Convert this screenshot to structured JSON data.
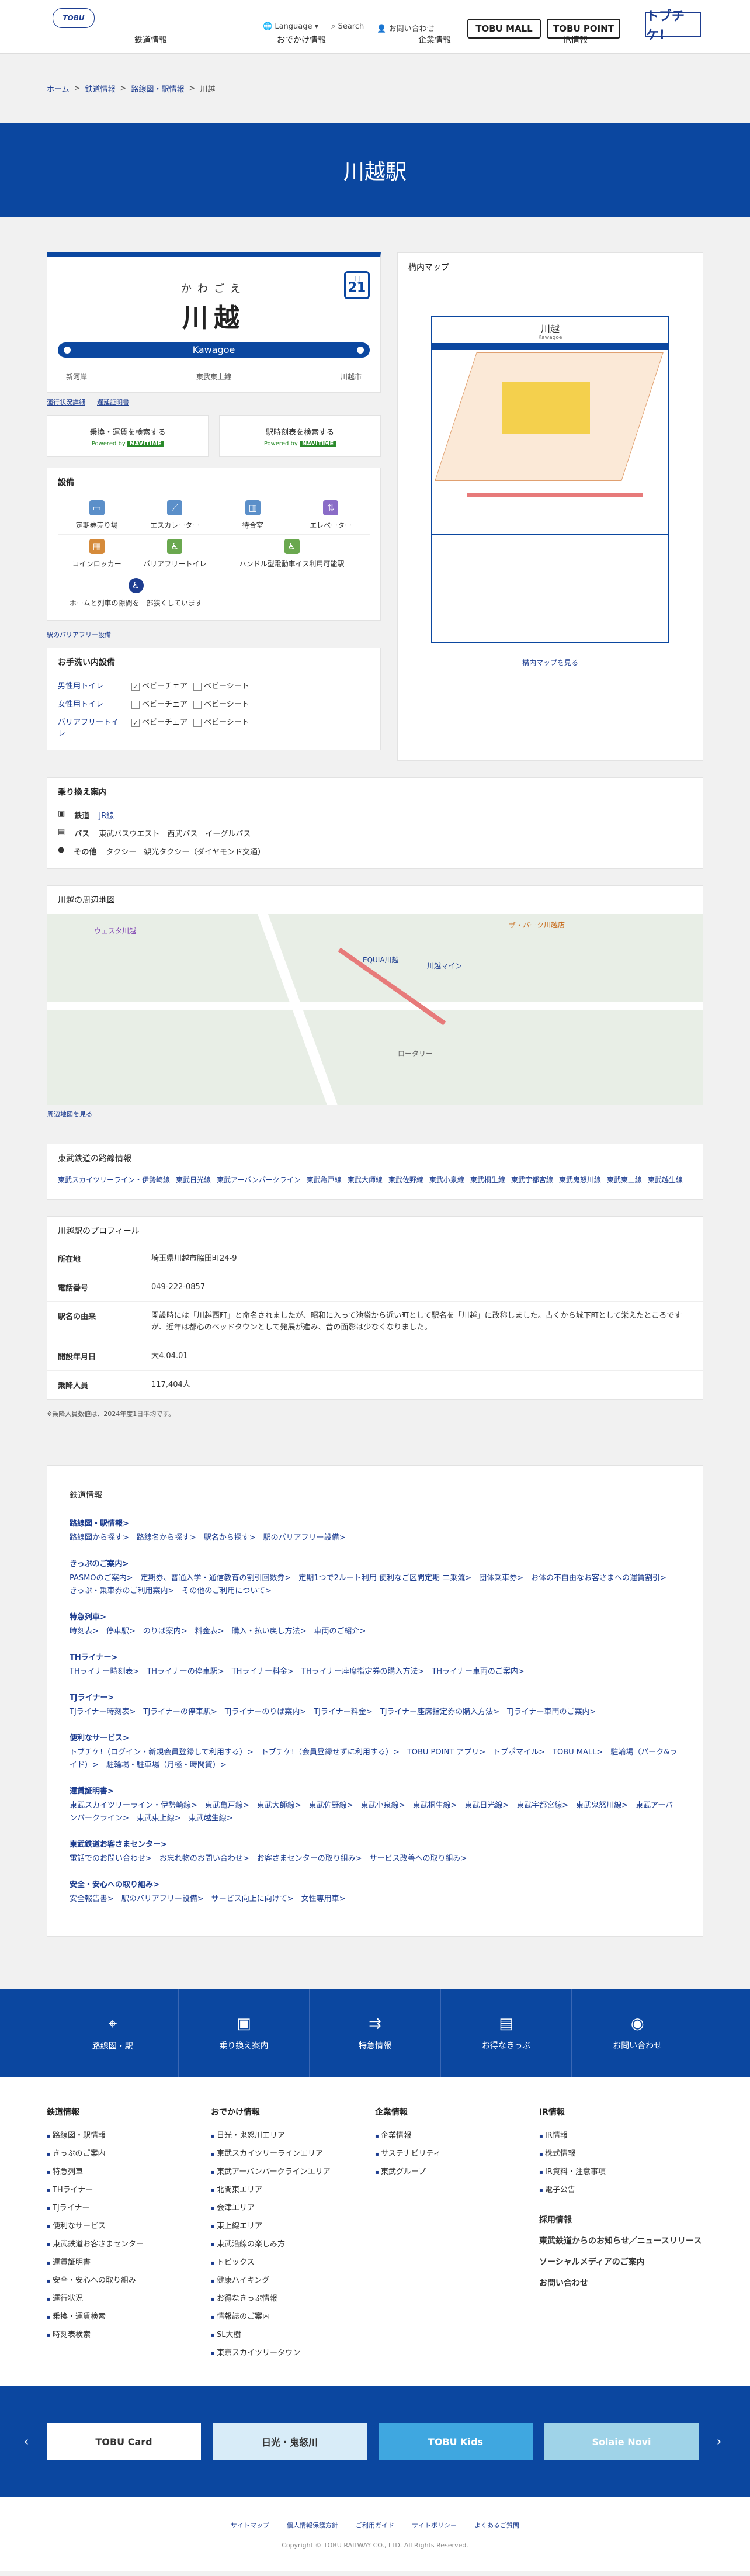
{
  "header": {
    "logo": "TOBU",
    "nav": [
      "鉄道情報",
      "おでかけ情報",
      "企業情報",
      "IR情報"
    ],
    "utility": [
      "Language ▾",
      "Search",
      "お問い合わせ"
    ],
    "brands": [
      "TOBU MALL",
      "TOBU POINT",
      "トブチケ!"
    ]
  },
  "breadcrumb": [
    "ホーム",
    "鉄道情報",
    "路線図・駅情報",
    "川越"
  ],
  "hero_title": "川越駅",
  "sign": {
    "kana": "かわごえ",
    "name": "川越",
    "romaji": "Kawagoe",
    "code_prefix": "TJ",
    "code_num": "21",
    "left": "新河岸",
    "center": "東武東上線",
    "right": "川越市"
  },
  "sign_links": [
    "運行状況詳細",
    "遅延証明書"
  ],
  "search_boxes": [
    {
      "label": "乗換・運賃を検索する",
      "powered": "Powered by",
      "brand": "NAVITIME"
    },
    {
      "label": "駅時刻表を検索する",
      "powered": "Powered by",
      "brand": "NAVITIME"
    }
  ],
  "facilities": {
    "title": "設備",
    "items": [
      "定期券売り場",
      "エスカレーター",
      "待合室",
      "エレベーター",
      "コインロッカー",
      "バリアフリートイレ",
      "ハンドル型電動車イス利用可能駅",
      "ホームと列車の隙間を一部狭くしています"
    ]
  },
  "barrier_link": "駅のバリアフリー設備",
  "toilets": {
    "title": "お手洗い内設備",
    "rows": [
      {
        "label": "男性用トイレ",
        "a": "ベビーチェア",
        "a_on": true,
        "b": "ベビーシート"
      },
      {
        "label": "女性用トイレ",
        "a": "ベビーチェア",
        "a_on": false,
        "b": "ベビーシート"
      },
      {
        "label": "バリアフリートイレ",
        "a": "ベビーチェア",
        "a_on": true,
        "b": "ベビーシート"
      }
    ]
  },
  "yard_map": {
    "title": "構内マップ",
    "map_title": "川越",
    "map_en": "Kawagoe",
    "link": "構内マップを見る"
  },
  "transfer": {
    "title": "乗り換え案内",
    "rows": [
      {
        "k": "鉄道",
        "v": "JR線"
      },
      {
        "k": "バス",
        "v": "東武バスウエスト　西武バス　イーグルバス"
      },
      {
        "k": "その他",
        "v": "タクシー　観光タクシー（ダイヤモンド交通）"
      }
    ]
  },
  "nearby": {
    "title": "川越の周辺地図",
    "link": "周辺地図を見る",
    "labels": [
      "ウェスタ川越",
      "EQUIA川越",
      "川越マイン",
      "ザ・パーク川越店",
      "ロータリー"
    ]
  },
  "route_lines": {
    "title": "東武鉄道の路線情報",
    "items": [
      "東武スカイツリーライン・伊勢崎線",
      "東武日光線",
      "東武アーバンパークライン",
      "東武亀戸線",
      "東武大師線",
      "東武佐野線",
      "東武小泉線",
      "東武桐生線",
      "東武宇都宮線",
      "東武鬼怒川線",
      "東武東上線",
      "東武越生線"
    ]
  },
  "profile": {
    "title": "川越駅のプロフィール",
    "rows": [
      {
        "k": "所在地",
        "v": "埼玉県川越市脇田町24-9"
      },
      {
        "k": "電話番号",
        "v": "049-222-0857"
      },
      {
        "k": "駅名の由来",
        "v": "開設時には「川越西町」と命名されましたが、昭和に入って池袋から近い町として駅名を「川越」に改称しました。古くから城下町として栄えたところですが、近年は都心のベッドタウンとして発展が進み、昔の面影は少なくなりました。"
      },
      {
        "k": "開設年月日",
        "v": "大4.04.01"
      },
      {
        "k": "乗降人員",
        "v": "117,404人"
      }
    ]
  },
  "profile_note": "※乗降人員数値は、2024年度1日平均です。",
  "sitemap": {
    "title": "鉄道情報",
    "groups": [
      {
        "h": "路線図・駅情報>",
        "p": "路線図から探す>　路線名から探す>　駅名から探す>　駅のバリアフリー設備>"
      },
      {
        "h": "きっぷのご案内>",
        "p": "PASMOのご案内>　定期券、普通入学・通信教育の割引回数券>　定期1つで2ルート利用 便利なご区間定期 二乗流>　団体乗車券>　お体の不自由なお客さまへの運賃割引>　きっぷ・乗車券のご利用案内>　その他のご利用について>"
      },
      {
        "h": "特急列車>",
        "p": "時刻表>　停車駅>　のりば案内>　料金表>　購入・払い戻し方法>　車両のご紹介>"
      },
      {
        "h": "THライナー>",
        "p": "THライナー時刻表>　THライナーの停車駅>　THライナー料金>　THライナー座席指定券の購入方法>　THライナー車両のご案内>"
      },
      {
        "h": "TJライナー>",
        "p": "TJライナー時刻表>　TJライナーの停車駅>　TJライナーのりば案内>　TJライナー料金>　TJライナー座席指定券の購入方法>　TJライナー車両のご案内>"
      },
      {
        "h": "便利なサービス>",
        "p": "トブチケ!（ログイン・新規会員登録して利用する）>　トブチケ!（会員登録せずに利用する）>　TOBU POINT アプリ>　トブポマイル>　TOBU MALL>　駐輪場（パーク&ライド）>　駐輪場・駐車場（月極・時間貸）>"
      },
      {
        "h": "運賃証明書>",
        "p": "東武スカイツリーライン・伊勢崎線>　東武亀戸線>　東武大師線>　東武佐野線>　東武小泉線>　東武桐生線>　東武日光線>　東武宇都宮線>　東武鬼怒川線>　東武アーバンパークライン>　東武東上線>　東武越生線>"
      },
      {
        "h": "東武鉄道お客さまセンター>",
        "p": "電話でのお問い合わせ>　お忘れ物のお問い合わせ>　お客さまセンターの取り組み>　サービス改善への取り組み>"
      },
      {
        "h": "安全・安心への取り組み>",
        "p": "安全報告書>　駅のバリアフリー設備>　サービス向上に向けて>　女性専用車>"
      }
    ]
  },
  "bluebar": [
    {
      "icon": "⌖",
      "label": "路線図・駅"
    },
    {
      "icon": "▣",
      "label": "乗り換え案内"
    },
    {
      "icon": "⇉",
      "label": "特急情報"
    },
    {
      "icon": "▤",
      "label": "お得なきっぷ"
    },
    {
      "icon": "◉",
      "label": "お問い合わせ"
    }
  ],
  "footer_cols": [
    {
      "h": "鉄道情報",
      "items": [
        "路線図・駅情報",
        "きっぷのご案内",
        "特急列車",
        "THライナー",
        "TJライナー",
        "便利なサービス",
        "東武鉄道お客さまセンター",
        "運賃証明書",
        "安全・安心への取り組み",
        "運行状況",
        "乗換・運賃検索",
        "時刻表検索"
      ]
    },
    {
      "h": "おでかけ情報",
      "items": [
        "日光・鬼怒川エリア",
        "東武スカイツリーラインエリア",
        "東武アーバンパークラインエリア",
        "北関東エリア",
        "会津エリア",
        "東上線エリア",
        "東武沿線の楽しみ方",
        "トピックス",
        "健康ハイキング",
        "お得なきっぷ情報",
        "情報誌のご案内",
        "SL大樹",
        "東京スカイツリータウン"
      ]
    },
    {
      "h": "企業情報",
      "items": [
        "企業情報",
        "サステナビリティ",
        "東武グループ"
      ]
    },
    {
      "h": "IR情報",
      "items": [
        "IR情報",
        "株式情報",
        "IR資料・注意事項",
        "電子公告"
      ],
      "big": [
        "採用情報",
        "東武鉄道からのお知らせ／ニュースリリース",
        "ソーシャルメディアのご案内",
        "お問い合わせ"
      ]
    }
  ],
  "banners": [
    "TOBU Card",
    "日光・鬼怒川",
    "TOBU Kids",
    "Solaie Novi"
  ],
  "footer": {
    "links": [
      "サイトマップ",
      "個人情報保護方針",
      "ご利用ガイド",
      "サイトポリシー",
      "よくあるご質問"
    ],
    "copy": "Copyright © TOBU RAILWAY CO., LTD. All Rights Reserved."
  }
}
